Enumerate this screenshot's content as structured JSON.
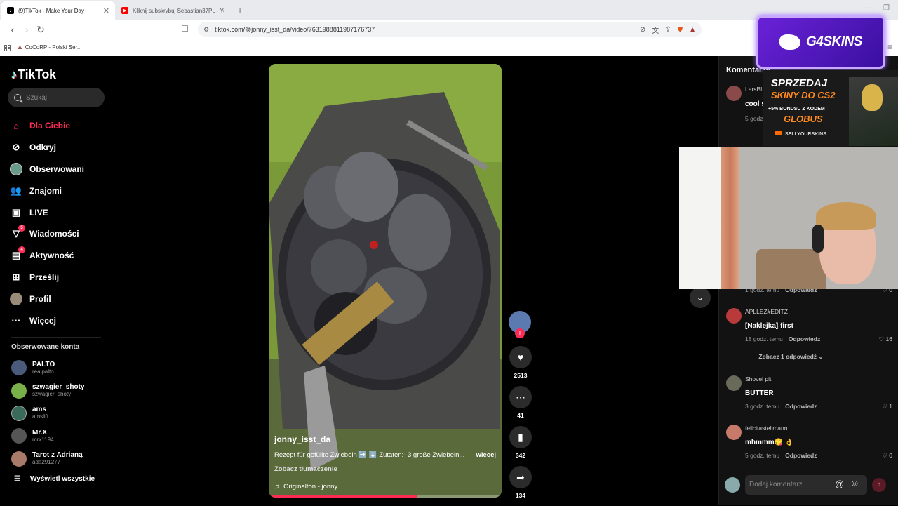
{
  "browser": {
    "tabs": [
      {
        "title": "(9)TikTok - Make Your Day",
        "active": true,
        "favicon": "tiktok-icon"
      },
      {
        "title": "Kliknij subskrybuj Sebastian37PL - Yo",
        "active": false,
        "favicon": "youtube-icon"
      }
    ],
    "url": "tiktok.com/@jonny_isst_da/video/7631988811987176737",
    "bookmarks": [
      {
        "label": "CoCoRP - Polski Ser..."
      }
    ]
  },
  "app": {
    "logo": "TikTok",
    "search_placeholder": "Szukaj",
    "nav": [
      {
        "label": "Dla Ciebie",
        "icon": "home-icon",
        "active": true,
        "badge": ""
      },
      {
        "label": "Odkryj",
        "icon": "compass-icon",
        "active": false,
        "badge": ""
      },
      {
        "label": "Obserwowani",
        "icon": "following-avatar-icon",
        "active": false,
        "badge": ""
      },
      {
        "label": "Znajomi",
        "icon": "friends-icon",
        "active": false,
        "badge": ""
      },
      {
        "label": "LIVE",
        "icon": "live-icon",
        "active": false,
        "badge": ""
      },
      {
        "label": "Wiadomości",
        "icon": "messages-icon",
        "active": false,
        "badge": "5"
      },
      {
        "label": "Aktywność",
        "icon": "activity-icon",
        "active": false,
        "badge": "4"
      },
      {
        "label": "Prześlij",
        "icon": "upload-icon",
        "active": false,
        "badge": ""
      },
      {
        "label": "Profil",
        "icon": "profile-avatar-icon",
        "active": false,
        "badge": ""
      },
      {
        "label": "Więcej",
        "icon": "more-icon",
        "active": false,
        "badge": ""
      }
    ],
    "followed_title": "Obserwowane konta",
    "followed": [
      {
        "name": "PALTO",
        "user": "realpalto",
        "color": "#4a5a7a"
      },
      {
        "name": "szwagier_shoty",
        "user": "szwagier_shoty",
        "color": "#7ab04a"
      },
      {
        "name": "ams",
        "user": "amslift",
        "color": "#3a6a5a"
      },
      {
        "name": "Mr.X",
        "user": "mrx1194",
        "color": "#555555"
      },
      {
        "name": "Tarot z Adrianą",
        "user": "ada291277",
        "color": "#a87a6a"
      }
    ],
    "show_all": "Wyświetl wszystkie"
  },
  "video": {
    "author": "jonny_isst_da",
    "description": "Rezept für gefüllte Zwiebeln ➡️ ⬇️ Zutaten:- 3 große Zwiebeln...",
    "more": "więcej",
    "translate": "Zobacz tłumaczenie",
    "music": "Originalton - jonny",
    "progress": 0.64
  },
  "actions": {
    "likes": "2513",
    "comments": "41",
    "saves": "342",
    "shares": "134"
  },
  "comments_panel": {
    "title": "Komentarze",
    "items": [
      {
        "user": "LarsBl...",
        "text": "cool s...",
        "time": "5 godz.",
        "reply": "",
        "likes": "",
        "thread": "",
        "color": "#8a4a4a"
      },
      {
        "user": "",
        "text": "",
        "time": "1 godz. temu",
        "reply": "Odpowiedz",
        "likes": "0",
        "thread": "",
        "color": ""
      },
      {
        "user": "APLLEZ#EDITZ",
        "text": "[Naklejka] first",
        "time": "18 godz. temu",
        "reply": "Odpowiedz",
        "likes": "16",
        "thread": "Zobacz 1 odpowiedź",
        "color": "#b83a3a"
      },
      {
        "user": "Shovel pit",
        "text": "BUTTER",
        "time": "3 godz. temu",
        "reply": "Odpowiedz",
        "likes": "1",
        "thread": "",
        "color": "#6a6a5a"
      },
      {
        "user": "felicitastellmann",
        "text": "mhmmm😋 👌",
        "time": "5 godz. temu",
        "reply": "Odpowiedz",
        "likes": "0",
        "thread": "",
        "color": "#c87a6a"
      }
    ],
    "input_placeholder": "Dodaj komentarz..."
  },
  "overlays": {
    "g4skins": "G4SKINS",
    "ad_line1": "SPRZEDAJ",
    "ad_line2": "SKINY DO CS2",
    "ad_line3": "+5% BONUSU Z KODEM",
    "ad_line4": "GLOBUS",
    "ad_line5": "SELLYOURSKINS"
  },
  "colors": {
    "accent": "#fe2c55",
    "background": "#000000",
    "panel": "#121212"
  }
}
